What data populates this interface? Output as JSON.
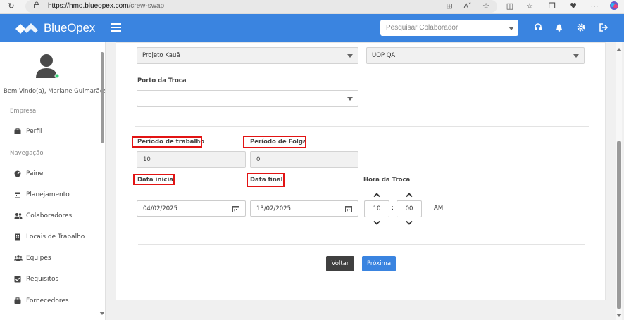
{
  "browser": {
    "url_host": "https://hmo.blueopex.com",
    "url_path": "/crew-swap"
  },
  "header": {
    "brand": "BlueOpex",
    "search_placeholder": "Pesquisar Colaborador",
    "accent_color": "#3a84e0"
  },
  "sidebar": {
    "welcome": "Bem Vindo(a), Mariane Guimarães",
    "section_empresa": "Empresa",
    "section_navegacao": "Navegação",
    "empresa_items": [
      {
        "label": "Perfil",
        "icon": "briefcase-icon"
      }
    ],
    "nav_items": [
      {
        "label": "Painel",
        "icon": "dashboard-icon"
      },
      {
        "label": "Planejamento",
        "icon": "calendar-icon"
      },
      {
        "label": "Colaboradores",
        "icon": "users-icon"
      },
      {
        "label": "Locais de Trabalho",
        "icon": "building-icon"
      },
      {
        "label": "Equipes",
        "icon": "team-icon"
      },
      {
        "label": "Requisitos",
        "icon": "checkbox-icon"
      },
      {
        "label": "Fornecedores",
        "icon": "briefcase-icon"
      }
    ]
  },
  "form": {
    "projeto_value": "Projeto Kauã",
    "uop_value": "UOP QA",
    "porto_label": "Porto da Troca",
    "porto_value": "",
    "periodo_trabalho_label": "Período de trabalho",
    "periodo_trabalho_value": "10",
    "periodo_folga_label": "Período de Folga",
    "periodo_folga_value": "0",
    "data_inicial_label": "Data inicial",
    "data_inicial_value": "04/02/2025",
    "data_final_label": "Data final",
    "data_final_value": "13/02/2025",
    "hora_label": "Hora da Troca",
    "hora_hours": "10",
    "hora_separator": ":",
    "hora_minutes": "00",
    "hora_period": "AM",
    "highlight_color": "#e21414"
  },
  "actions": {
    "back_label": "Voltar",
    "next_label": "Próxima"
  }
}
